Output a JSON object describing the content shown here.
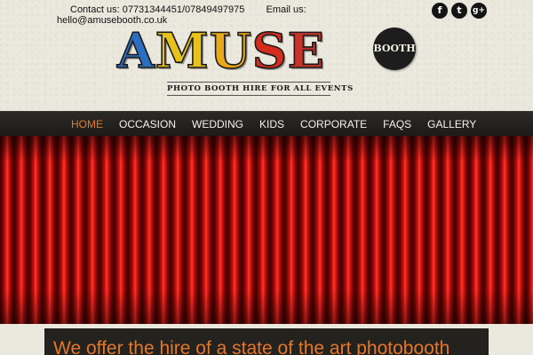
{
  "header": {
    "contact_label": "Contact us:",
    "phone": "07731344451/07849497975",
    "email_label": "Email us:",
    "email": "hello@amusebooth.co.uk",
    "social": [
      {
        "icon": "facebook-icon",
        "glyph": "f"
      },
      {
        "icon": "twitter-icon",
        "glyph": "t"
      },
      {
        "icon": "google-plus-icon",
        "glyph": "g+"
      }
    ]
  },
  "logo": {
    "letters": [
      "A",
      "M",
      "U",
      "S",
      "E"
    ],
    "letter_colors": [
      "#2c6fc0",
      "#e8c21a",
      "#e8a81a",
      "#d52b1e",
      "#c4342a"
    ],
    "badge": "BOOTH",
    "tagline": "PHOTO BOOTH HIRE FOR ALL EVENTS"
  },
  "nav": {
    "items": [
      "HOME",
      "OCCASION",
      "WEDDING",
      "KIDS",
      "CORPORATE",
      "FAQS",
      "GALLERY"
    ],
    "active_color": "#e07a2b"
  },
  "main": {
    "headline": "We offer the hire of a state of the art photobooth"
  }
}
